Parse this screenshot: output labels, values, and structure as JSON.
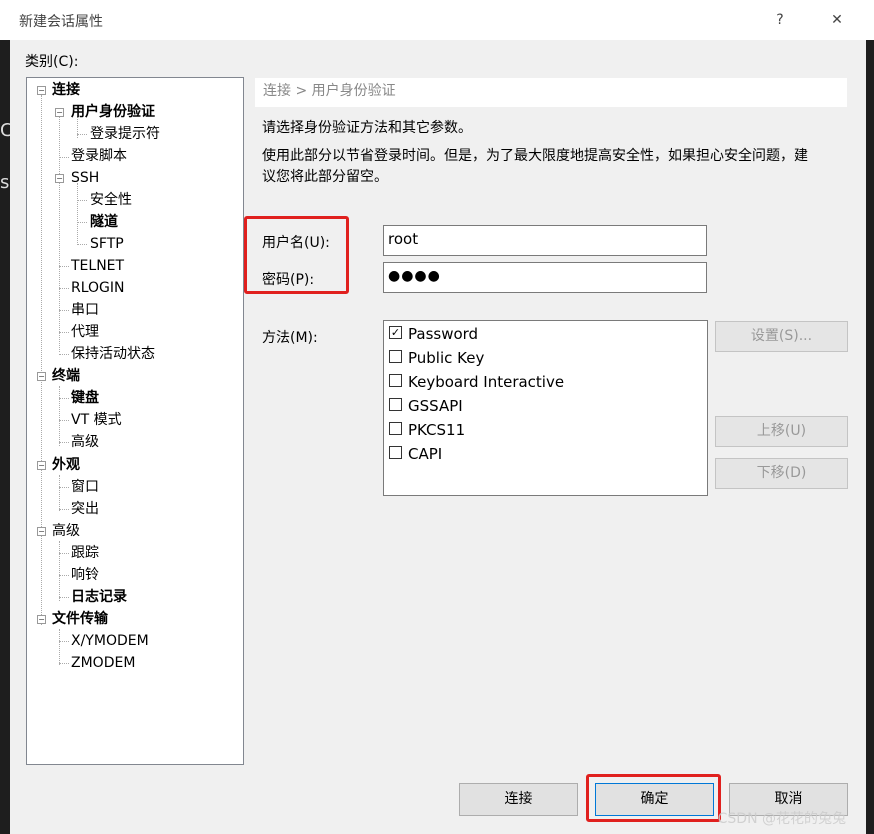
{
  "window": {
    "title": "新建会话属性",
    "help_button": "?",
    "close_button": "✕"
  },
  "background": {
    "fragments": [
      "C",
      "s"
    ]
  },
  "category": {
    "label": "类别(C):"
  },
  "tree": {
    "items": [
      {
        "label": "连接",
        "bold": true,
        "expander": "−"
      },
      {
        "label": "用户身份验证",
        "bold": true,
        "expander": "−"
      },
      {
        "label": "登录提示符",
        "bold": false
      },
      {
        "label": "登录脚本",
        "bold": false
      },
      {
        "label": "SSH",
        "bold": false,
        "expander": "−"
      },
      {
        "label": "安全性",
        "bold": false
      },
      {
        "label": "隧道",
        "bold": true
      },
      {
        "label": "SFTP",
        "bold": false
      },
      {
        "label": "TELNET",
        "bold": false
      },
      {
        "label": "RLOGIN",
        "bold": false
      },
      {
        "label": "串口",
        "bold": false
      },
      {
        "label": "代理",
        "bold": false
      },
      {
        "label": "保持活动状态",
        "bold": false
      },
      {
        "label": "终端",
        "bold": true,
        "expander": "−"
      },
      {
        "label": "键盘",
        "bold": true
      },
      {
        "label": "VT 模式",
        "bold": false
      },
      {
        "label": "高级",
        "bold": false
      },
      {
        "label": "外观",
        "bold": true,
        "expander": "−"
      },
      {
        "label": "窗口",
        "bold": false
      },
      {
        "label": "突出",
        "bold": false
      },
      {
        "label": "高级",
        "bold": false,
        "expander": "−"
      },
      {
        "label": "跟踪",
        "bold": false
      },
      {
        "label": "响铃",
        "bold": false
      },
      {
        "label": "日志记录",
        "bold": true
      },
      {
        "label": "文件传输",
        "bold": true,
        "expander": "−"
      },
      {
        "label": "X/YMODEM",
        "bold": false
      },
      {
        "label": "ZMODEM",
        "bold": false
      }
    ]
  },
  "panel": {
    "breadcrumb": "连接 > 用户身份验证",
    "desc1": "请选择身份验证方法和其它参数。",
    "desc2_line1": "使用此部分以节省登录时间。但是，为了最大限度地提高安全性，如果担心安全问题，建",
    "desc2_line2": "议您将此部分留空。",
    "username_label": "用户名(U):",
    "username_value": "root",
    "password_label": "密码(P):",
    "password_value": "●●●●",
    "method_label": "方法(M):",
    "methods": [
      {
        "label": "Password",
        "checked": true
      },
      {
        "label": "Public Key",
        "checked": false
      },
      {
        "label": "Keyboard Interactive",
        "checked": false
      },
      {
        "label": "GSSAPI",
        "checked": false
      },
      {
        "label": "PKCS11",
        "checked": false
      },
      {
        "label": "CAPI",
        "checked": false
      }
    ],
    "settings_button": "设置(S)...",
    "move_up_button": "上移(U)",
    "move_down_button": "下移(D)"
  },
  "footer": {
    "connect_button": "连接",
    "ok_button": "确定",
    "cancel_button": "取消"
  },
  "watermark": "CSDN @花花的兔兔",
  "colors": {
    "highlight": "#e0201e",
    "dialog_bg": "#f0f0f0"
  }
}
